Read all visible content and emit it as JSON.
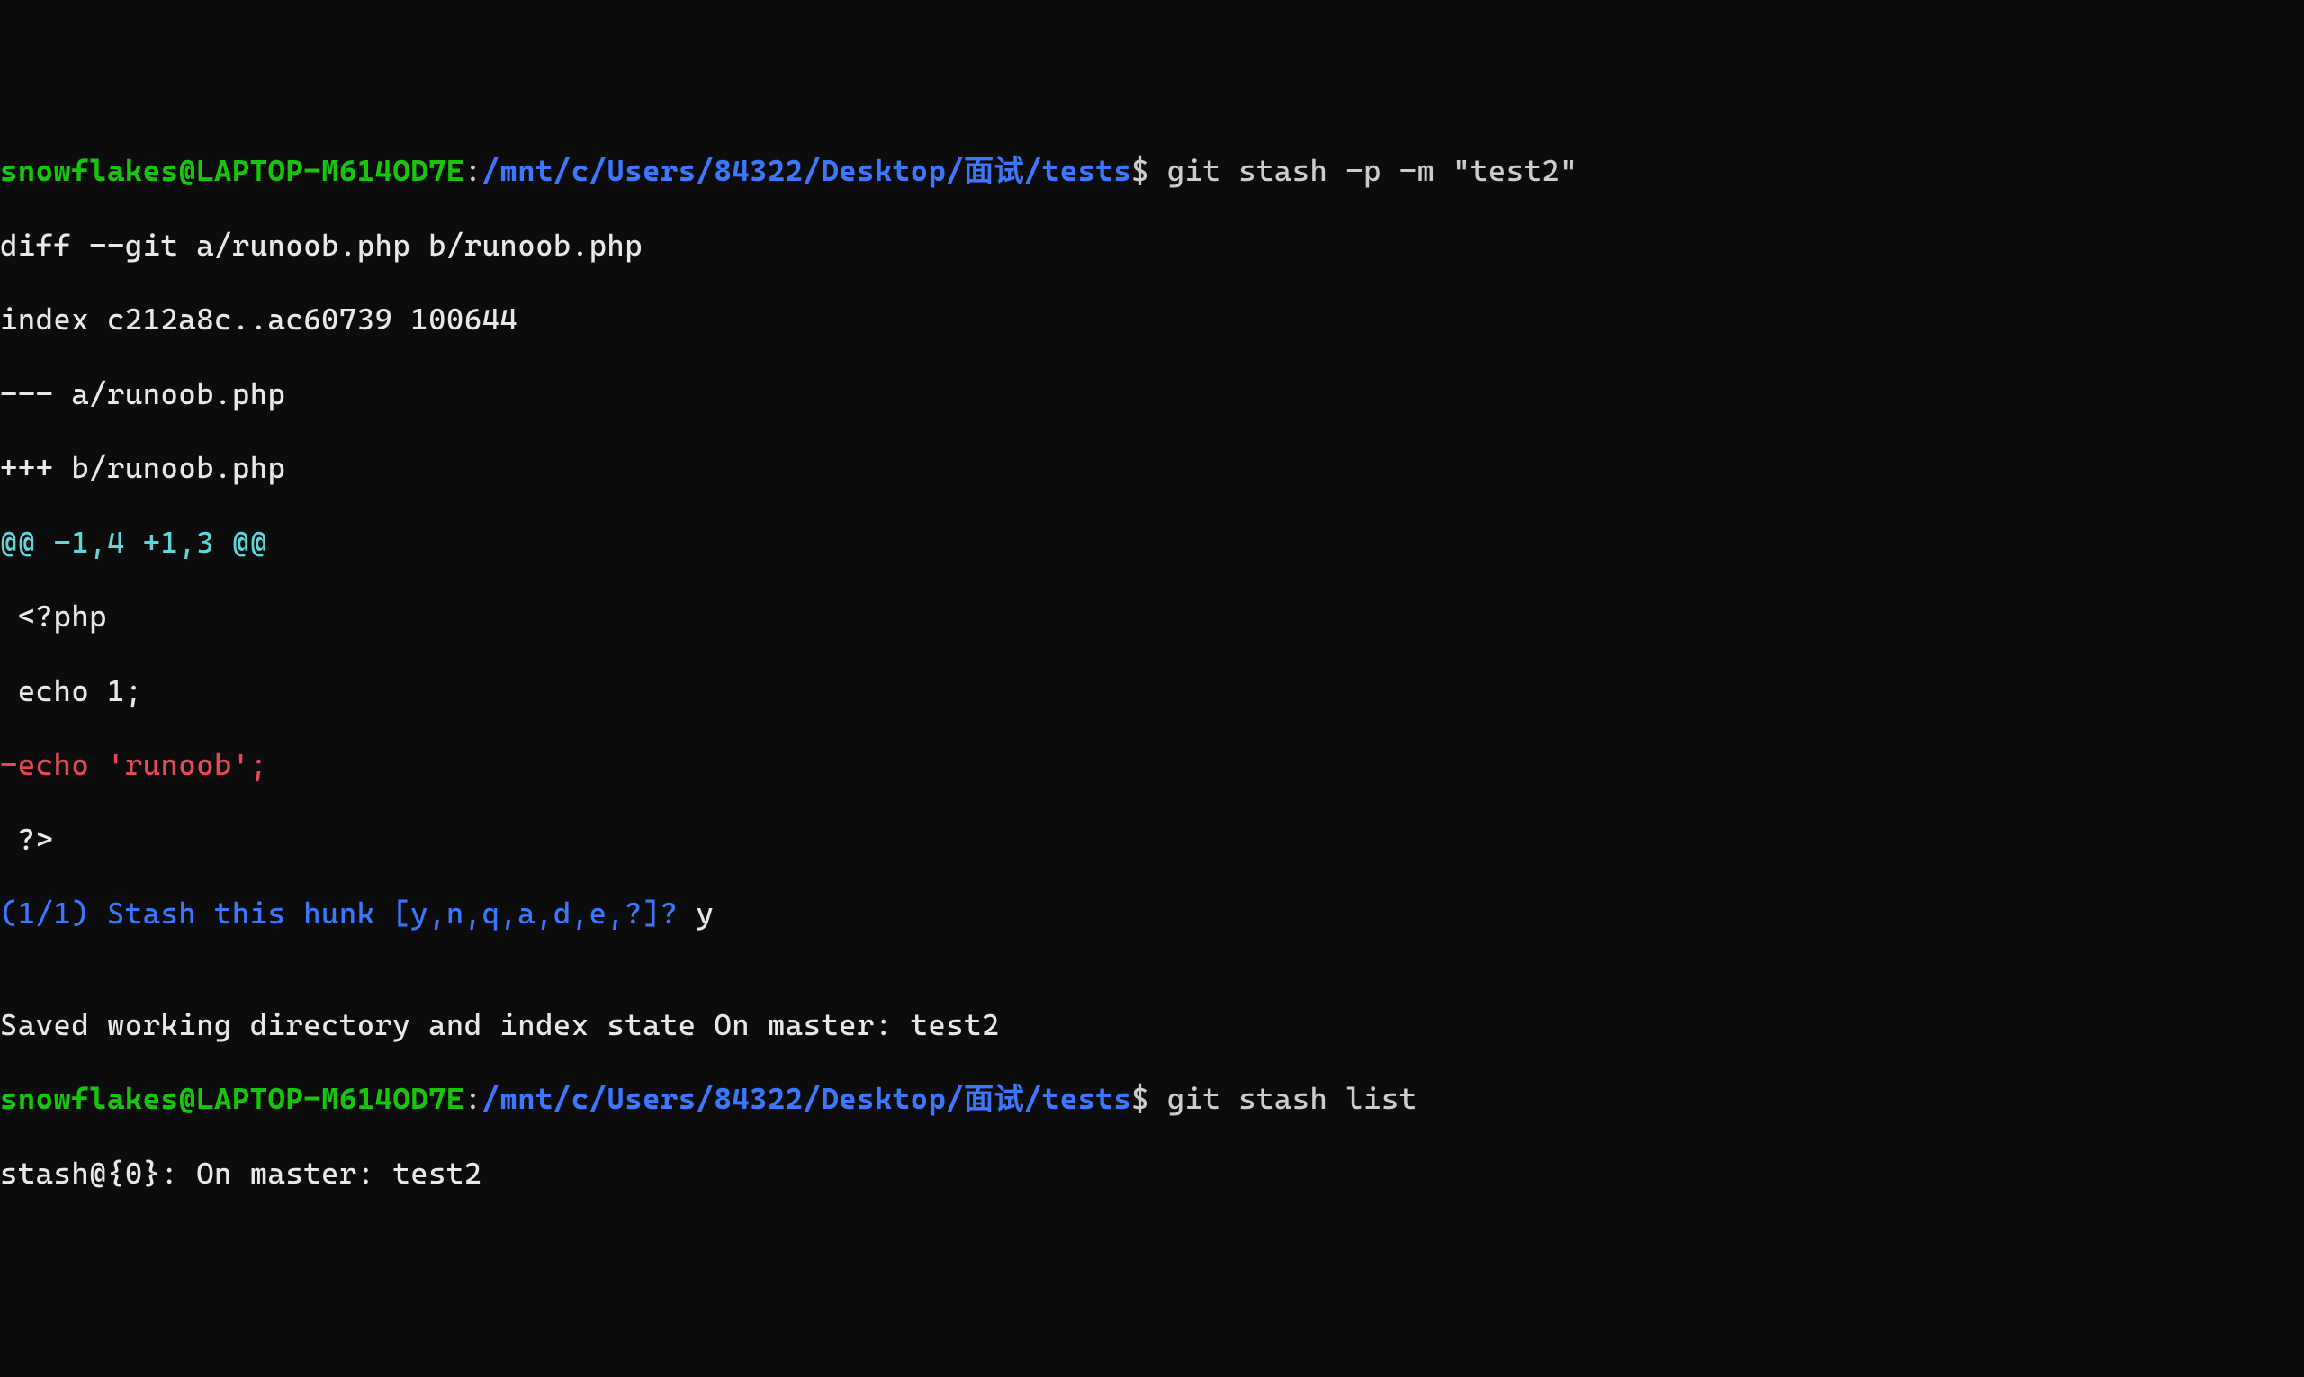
{
  "prompt1": {
    "user": "snowflakes@LAPTOP-M614OD7E",
    "colon": ":",
    "path": "/mnt/c/Users/84322/Desktop/面试/tests",
    "dollar": "$ ",
    "command": "git stash -p -m \"test2\""
  },
  "diff": {
    "header": "diff --git a/runoob.php b/runoob.php",
    "index": "index c212a8c..ac60739 100644",
    "minus_file": "--- a/runoob.php",
    "plus_file": "+++ b/runoob.php",
    "hunk": "@@ -1,4 +1,3 @@",
    "ctx1": " <?php",
    "ctx2": " echo 1;",
    "del1": "-echo 'runoob';",
    "ctx3": " ?>"
  },
  "stash_prompt": {
    "question": "(1/1) Stash this hunk [y,n,q,a,d,e,?]? ",
    "answer": "y"
  },
  "blank": "",
  "saved": "Saved working directory and index state On master: test2",
  "prompt2": {
    "user": "snowflakes@LAPTOP-M614OD7E",
    "colon": ":",
    "path": "/mnt/c/Users/84322/Desktop/面试/tests",
    "dollar": "$ ",
    "command": "git stash list"
  },
  "stash_list_out": "stash@{0}: On master: test2"
}
